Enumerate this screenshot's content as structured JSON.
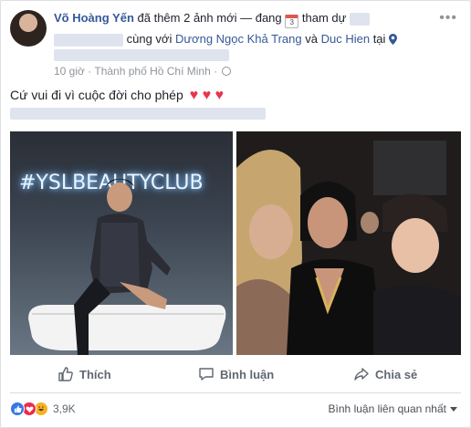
{
  "post": {
    "author": "Võ Hoàng Yến",
    "action_text": "đã thêm 2 ảnh mới — đang",
    "calendar_day": "3",
    "attending_text": "tham dự",
    "with_text": "cùng với",
    "tagged_1": "Dương Ngọc Khả Trang",
    "and_text": "và",
    "tagged_2": "Duc Hien",
    "at_text": "tại",
    "time": "10 giờ",
    "location": "Thành phố Hồ Chí Minh",
    "separator": "·",
    "caption": "Cứ vui đi vì cuộc đời cho phép",
    "caption_emojis": "♥ ♥ ♥",
    "more": "•••"
  },
  "photos": {
    "neon_text": "#YSLBEAUTYCLUB"
  },
  "actions": {
    "like": "Thích",
    "comment": "Bình luận",
    "share": "Chia sẻ"
  },
  "footer": {
    "reaction_count": "3,9K",
    "sort_label": "Bình luận liên quan nhất"
  },
  "colors": {
    "link": "#365899",
    "like_blue": "#3578e5",
    "love_red": "#f0284a",
    "haha_yellow": "#f7b125"
  }
}
